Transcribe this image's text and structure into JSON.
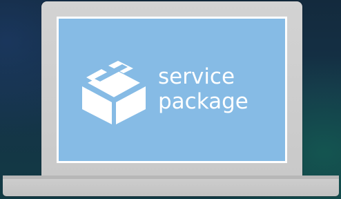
{
  "screen": {
    "line1": "service",
    "line2": "package",
    "icon": "package-box-icon",
    "background_color": "#86bbe5",
    "text_color": "#ffffff"
  },
  "device": {
    "type": "laptop",
    "frame_color": "#cfcfcf"
  }
}
